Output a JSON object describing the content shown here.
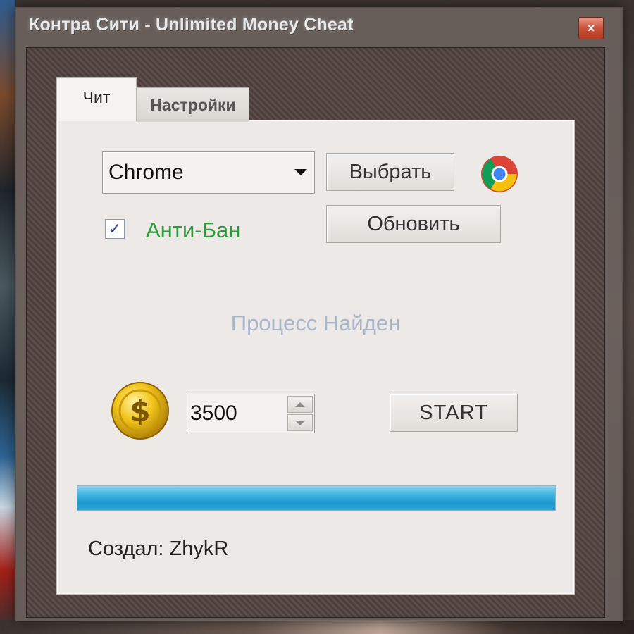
{
  "window": {
    "title": "Контра Сити -  Unlimited Money Cheat",
    "close_symbol": "×"
  },
  "tabs": [
    {
      "label": "Чит",
      "active": true
    },
    {
      "label": "Настройки",
      "active": false
    }
  ],
  "process_select": {
    "value": "Chrome"
  },
  "buttons": {
    "select_label": "Выбрать",
    "refresh_label": "Обновить",
    "start_label": "START"
  },
  "anti_ban": {
    "label": "Анти-Бан",
    "checked": true,
    "check_mark": "✓"
  },
  "status_text": "Процесс Найден",
  "money": {
    "value": "3500"
  },
  "progress": {
    "percent": 100
  },
  "creator_text": "Создал: ZhykR",
  "icons": {
    "process_icon": "chrome-icon",
    "money_icon": "coin-dollar-icon"
  },
  "colors": {
    "anti_ban_label": "#2e9a3a",
    "status_text": "#a8b6cc",
    "progress_fill": "#1d98cf",
    "close_button": "#c9533a"
  }
}
